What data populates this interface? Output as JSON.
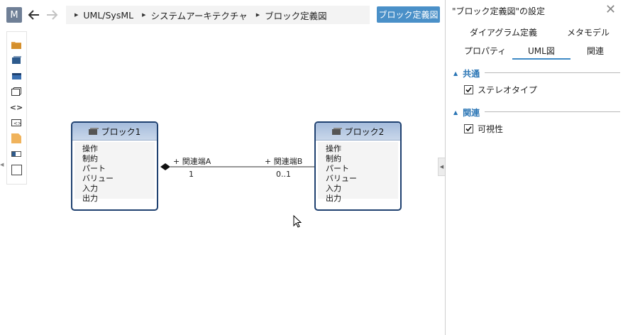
{
  "toolbar": {
    "m_label": "M",
    "back_icon": "arrow-left-icon",
    "forward_icon": "arrow-right-icon",
    "diagram_button": "ブロック定義図"
  },
  "breadcrumb": [
    "UML/SysML",
    "システムアーキテクチャ",
    "ブロック定義図"
  ],
  "palette": [
    "folder-icon",
    "block-icon",
    "block-filled-icon",
    "frame-icon",
    "code-icon",
    "interface-icon",
    "note-icon",
    "port-icon",
    "rectangle-icon"
  ],
  "diagram": {
    "block1": {
      "name": "ブロック1",
      "compartments": [
        "操作",
        "制約",
        "パート",
        "バリュー",
        "入力",
        "出力"
      ]
    },
    "block2": {
      "name": "ブロック2",
      "compartments": [
        "操作",
        "制約",
        "パート",
        "バリュー",
        "入力",
        "出力"
      ]
    },
    "association": {
      "end_a_name": "+ 関連端A",
      "end_a_mult": "1",
      "end_b_name": "+ 関連端B",
      "end_b_mult": "0..1"
    }
  },
  "panel": {
    "title": "\"ブロック定義図\"の設定",
    "tabs_row1": [
      "ダイアグラム定義",
      "メタモデル"
    ],
    "tabs_row2": [
      "プロパティ",
      "UML図",
      "関連"
    ],
    "active_tab": "UML図",
    "sections": [
      {
        "title": "共通",
        "options": [
          {
            "label": "ステレオタイプ",
            "checked": true
          }
        ]
      },
      {
        "title": "関連",
        "options": [
          {
            "label": "可視性",
            "checked": true
          }
        ]
      }
    ]
  },
  "colors": {
    "accent": "#4a90c8",
    "block_border": "#1f4170",
    "section": "#2a75b5"
  }
}
